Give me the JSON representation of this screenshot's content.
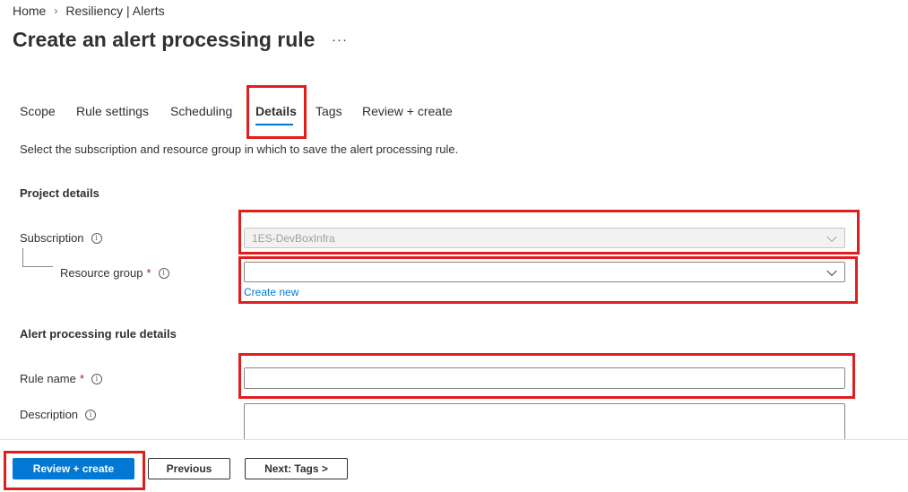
{
  "breadcrumb": {
    "home": "Home",
    "current": "Resiliency | Alerts",
    "separator": "›"
  },
  "page": {
    "title": "Create an alert processing rule",
    "more_label": "···"
  },
  "tabs": [
    {
      "label": "Scope"
    },
    {
      "label": "Rule settings"
    },
    {
      "label": "Scheduling"
    },
    {
      "label": "Details",
      "active": true
    },
    {
      "label": "Tags"
    },
    {
      "label": "Review + create"
    }
  ],
  "description": "Select the subscription and resource group in which to save the alert processing rule.",
  "project_details": {
    "heading": "Project details",
    "subscription": {
      "label": "Subscription",
      "value": "1ES-DevBoxInfra",
      "disabled": true
    },
    "resource_group": {
      "label": "Resource group",
      "required_mark": "*",
      "value": "",
      "create_new": "Create new"
    }
  },
  "rule_details": {
    "heading": "Alert processing rule details",
    "rule_name": {
      "label": "Rule name",
      "required_mark": "*",
      "value": ""
    },
    "description": {
      "label": "Description",
      "value": ""
    }
  },
  "footer": {
    "review_create": "Review + create",
    "previous": "Previous",
    "next": "Next: Tags >"
  },
  "icons": {
    "info": "info-icon",
    "chevron": "chevron-down-icon"
  },
  "colors": {
    "accent": "#0078d4",
    "highlight": "#e01e1e",
    "required": "#a4262c"
  }
}
